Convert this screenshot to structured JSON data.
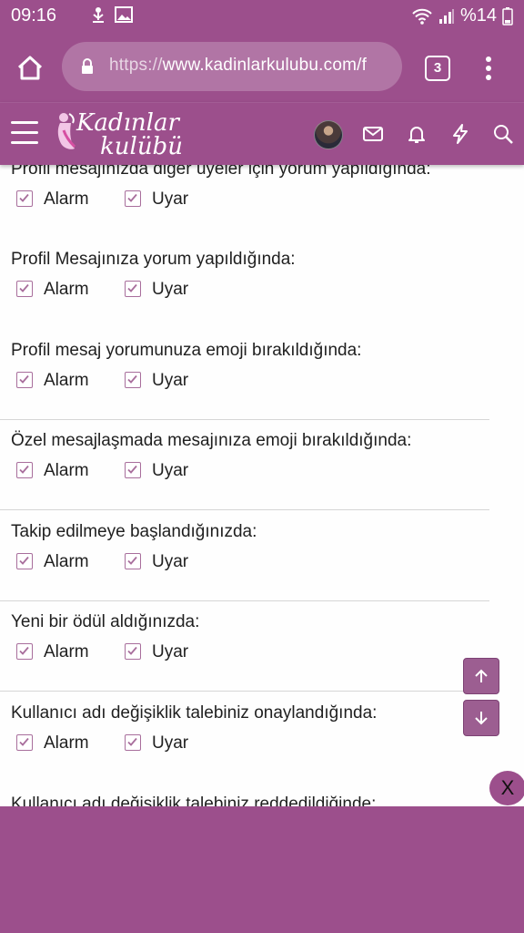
{
  "status_bar": {
    "time": "09:16",
    "battery": "%14",
    "icons": [
      "usb-icon",
      "image-icon",
      "wifi-icon",
      "signal-icon"
    ]
  },
  "browser": {
    "url_scheme": "https://",
    "url_host": "www.kadinlarkulubu.com/f",
    "tab_count": "3"
  },
  "site_header": {
    "logo_line1": "Kadınlar",
    "logo_line2": "kulübü",
    "icons": [
      "menu-icon",
      "avatar",
      "mail-icon",
      "bell-icon",
      "bolt-icon",
      "search-icon"
    ]
  },
  "options": {
    "alarm": "Alarm",
    "uyar": "Uyar"
  },
  "items": [
    {
      "label": "Profil mesajınızda diğer üyeler için yorum yapıldığında:",
      "alarm": true,
      "uyar": true
    },
    {
      "label": "Profil Mesajınıza yorum yapıldığında:",
      "alarm": true,
      "uyar": true
    },
    {
      "label": "Profil mesaj yorumunuza emoji bırakıldığında:",
      "alarm": true,
      "uyar": true
    },
    {
      "label": "Özel mesajlaşmada mesajınıza emoji bırakıldığında:",
      "alarm": true,
      "uyar": true
    },
    {
      "label": "Takip edilmeye başlandığınızda:",
      "alarm": true,
      "uyar": true
    },
    {
      "label": "Yeni bir ödül aldığınızda:",
      "alarm": true,
      "uyar": true
    },
    {
      "label": "Kullanıcı adı değişiklik talebiniz onaylandığında:",
      "alarm": true,
      "uyar": true
    },
    {
      "label": "Kullanıcı adı değişiklik talebiniz reddedildiğinde:"
    }
  ],
  "close_button": "X",
  "colors": {
    "brand": "#9c4f8c",
    "checkbox": "#a86e9c",
    "text": "#1f1f1f"
  }
}
